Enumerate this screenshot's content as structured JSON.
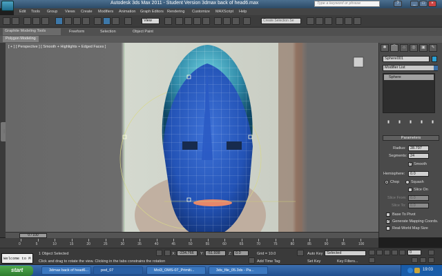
{
  "titlebar": {
    "title": "Autodesk 3ds Max  2011   -  Student Version     3dmax back of head6.max",
    "search_placeholder": "Type a keyword or phrase"
  },
  "menu": [
    "Edit",
    "Tools",
    "Group",
    "Views",
    "Create",
    "Modifiers",
    "Animation",
    "Graph Editors",
    "Rendering",
    "Customize",
    "MAXScript",
    "Help"
  ],
  "toolbar": {
    "view_dropdown": "View",
    "selection_set": "Create Selection Se"
  },
  "ribbon": {
    "tabs": [
      "Graphite Modeling Tools",
      "Freeform",
      "Selection",
      "Object Paint"
    ],
    "panel_label": "Polygon Modeling"
  },
  "viewport": {
    "label": "[ + ] [ Perspective ] [ Smooth + Highlights + Edged Faces ]"
  },
  "command_panel": {
    "object_name": "Sphere001",
    "modifier_list": "Modifier List",
    "stack_items": [
      "Sphere"
    ],
    "rollout_title": "Parameters",
    "radius_label": "Radius:",
    "radius": "28.797",
    "segments_label": "Segments:",
    "segments": "24",
    "smooth_label": "Smooth",
    "hemisphere_label": "Hemisphere:",
    "hemisphere": "0.0",
    "chop_label": "Chop",
    "squash_label": "Squash",
    "slice_on_label": "Slice On",
    "slice_from_label": "Slice From:",
    "slice_from": "0.0",
    "slice_to_label": "Slice To:",
    "slice_to": "0.0",
    "base_to_pivot_label": "Base To Pivot",
    "gen_mapping_label": "Generate Mapping Coords.",
    "real_world_label": "Real-World Map Size"
  },
  "timeline": {
    "slider": "0 / 100",
    "ticks": [
      "0",
      "5",
      "10",
      "15",
      "20",
      "25",
      "30",
      "35",
      "40",
      "45",
      "50",
      "55",
      "60",
      "65",
      "70",
      "75",
      "80",
      "85",
      "90",
      "95",
      "100"
    ]
  },
  "status": {
    "maxscript": "Welcome to M",
    "selection_text": "1 Object Selected",
    "prompt": "Click and drag to rotate the view.  Clicking in the tabs constrains the rotation",
    "x_label": "X:",
    "x_value": "-234.766",
    "y_label": "Y:",
    "y_value": "-51.938",
    "z_label": "Z:",
    "z_value": "0.0",
    "grid": "Grid = 10.0",
    "add_time_tag": "Add Time Tag",
    "auto_key": "Auto Key",
    "set_key": "Set Key",
    "key_mode": "Selected",
    "key_filters": "Key Filters...",
    "frame": "0"
  },
  "taskbar": {
    "start": "start",
    "tasks": [
      "3dmax back of head6...",
      "pod_07",
      "Mol3_OMS-07_Primiti...",
      "3ds_file_05.3ds - Pa..."
    ],
    "clock": "19:03"
  }
}
